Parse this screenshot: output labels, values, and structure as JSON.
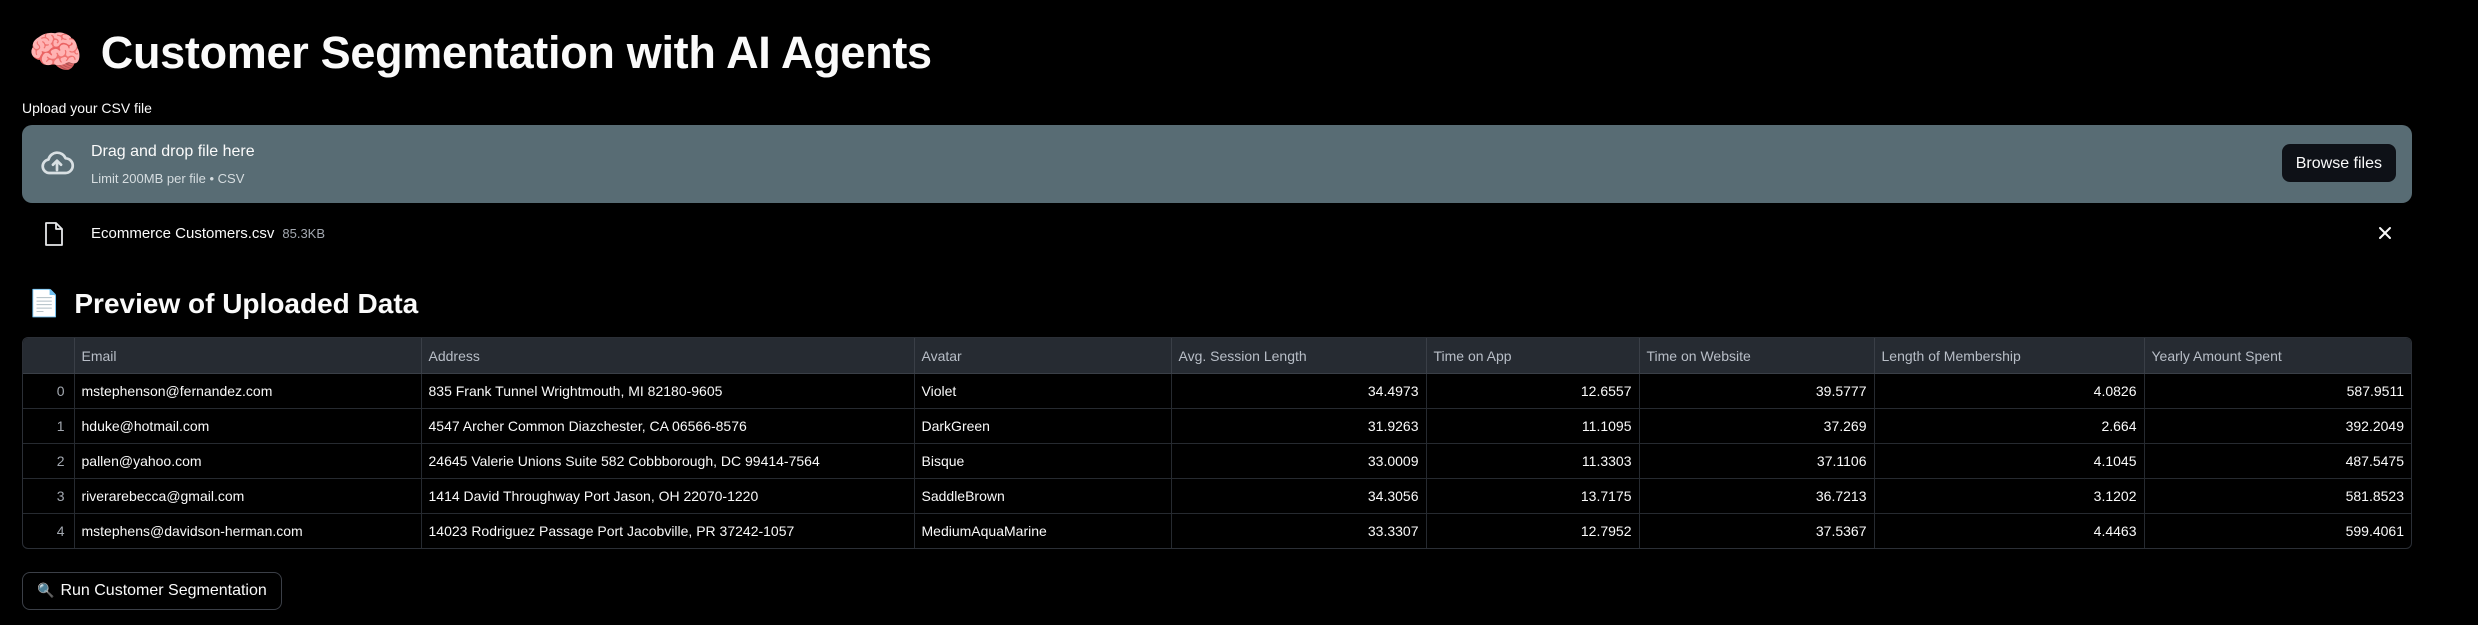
{
  "page": {
    "title_emoji": "🧠",
    "title": "Customer Segmentation with AI Agents"
  },
  "uploader": {
    "label": "Upload your CSV file",
    "drop_title": "Drag and drop file here",
    "drop_subtitle": "Limit 200MB per file • CSV",
    "browse_label": "Browse files",
    "file_name": "Ecommerce Customers.csv",
    "file_size": "85.3KB",
    "icons": {
      "upload": "cloud-upload-icon",
      "file": "file-icon",
      "remove": "close-icon"
    }
  },
  "preview": {
    "emoji": "📄",
    "title": "Preview of Uploaded Data",
    "columns": [
      "",
      "Email",
      "Address",
      "Avatar",
      "Avg. Session Length",
      "Time on App",
      "Time on Website",
      "Length of Membership",
      "Yearly Amount Spent"
    ],
    "rows": [
      [
        "0",
        "mstephenson@fernandez.com",
        "835 Frank Tunnel Wrightmouth, MI 82180-9605",
        "Violet",
        "34.4973",
        "12.6557",
        "39.5777",
        "4.0826",
        "587.9511"
      ],
      [
        "1",
        "hduke@hotmail.com",
        "4547 Archer Common Diazchester, CA 06566-8576",
        "DarkGreen",
        "31.9263",
        "11.1095",
        "37.269",
        "2.664",
        "392.2049"
      ],
      [
        "2",
        "pallen@yahoo.com",
        "24645 Valerie Unions Suite 582 Cobbborough, DC 99414-7564",
        "Bisque",
        "33.0009",
        "11.3303",
        "37.1106",
        "4.1045",
        "487.5475"
      ],
      [
        "3",
        "riverarebecca@gmail.com",
        "1414 David Throughway Port Jason, OH 22070-1220",
        "SaddleBrown",
        "34.3056",
        "13.7175",
        "36.7213",
        "3.1202",
        "581.8523"
      ],
      [
        "4",
        "mstephens@davidson-herman.com",
        "14023 Rodriguez Passage Port Jacobville, PR 37242-1057",
        "MediumAquaMarine",
        "33.3307",
        "12.7952",
        "37.5367",
        "4.4463",
        "599.4061"
      ]
    ]
  },
  "actions": {
    "run_emoji": "🔍",
    "run_label": "Run Customer Segmentation"
  }
}
